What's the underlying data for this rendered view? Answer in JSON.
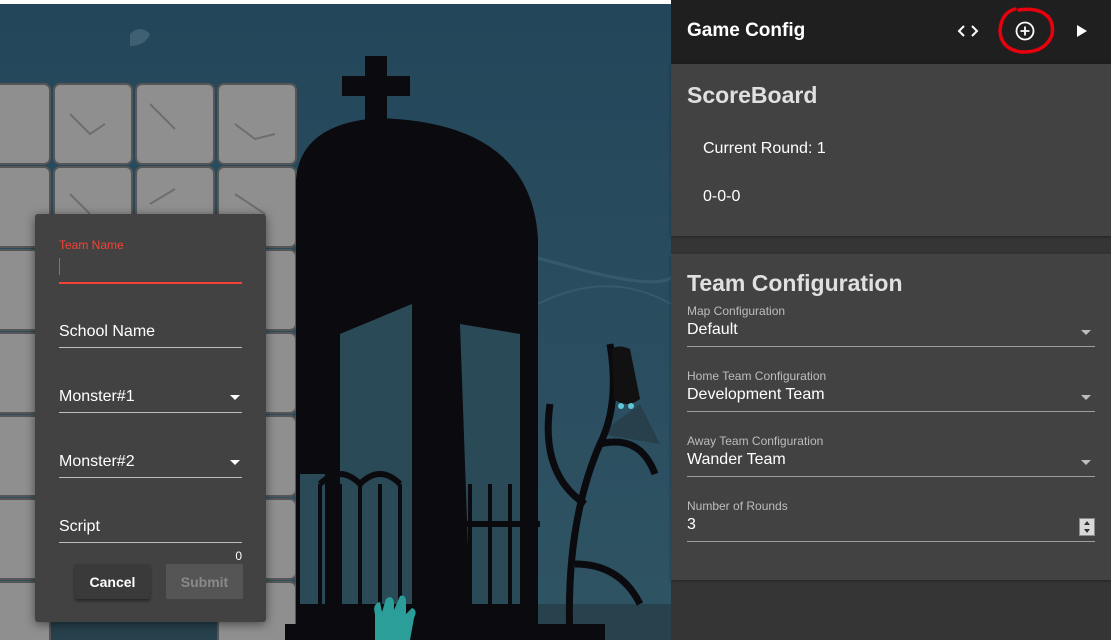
{
  "team_form": {
    "team_name_label": "Team Name",
    "team_name_value": "",
    "school_name_placeholder": "School Name",
    "monster1_placeholder": "Monster#1",
    "monster2_placeholder": "Monster#2",
    "script_placeholder": "Script",
    "script_char_count": "0",
    "cancel_label": "Cancel",
    "submit_label": "Submit"
  },
  "appbar": {
    "title": "Game Config",
    "icons": [
      "code-icon",
      "add-circle-icon",
      "play-icon"
    ]
  },
  "scoreboard": {
    "title": "ScoreBoard",
    "current_round": "Current Round: 1",
    "score": "0-0-0"
  },
  "team_config": {
    "title": "Team Configuration",
    "map": {
      "label": "Map Configuration",
      "value": "Default"
    },
    "home": {
      "label": "Home Team Configuration",
      "value": "Development Team"
    },
    "away": {
      "label": "Away Team Configuration",
      "value": "Wander Team"
    },
    "rounds": {
      "label": "Number of Rounds",
      "value": "3"
    }
  },
  "colors": {
    "accent_error": "#f44336",
    "panel_bg": "#353535",
    "card_bg": "#424242",
    "appbar_bg": "#1f1f1f",
    "annotation_red": "#e8000d"
  }
}
